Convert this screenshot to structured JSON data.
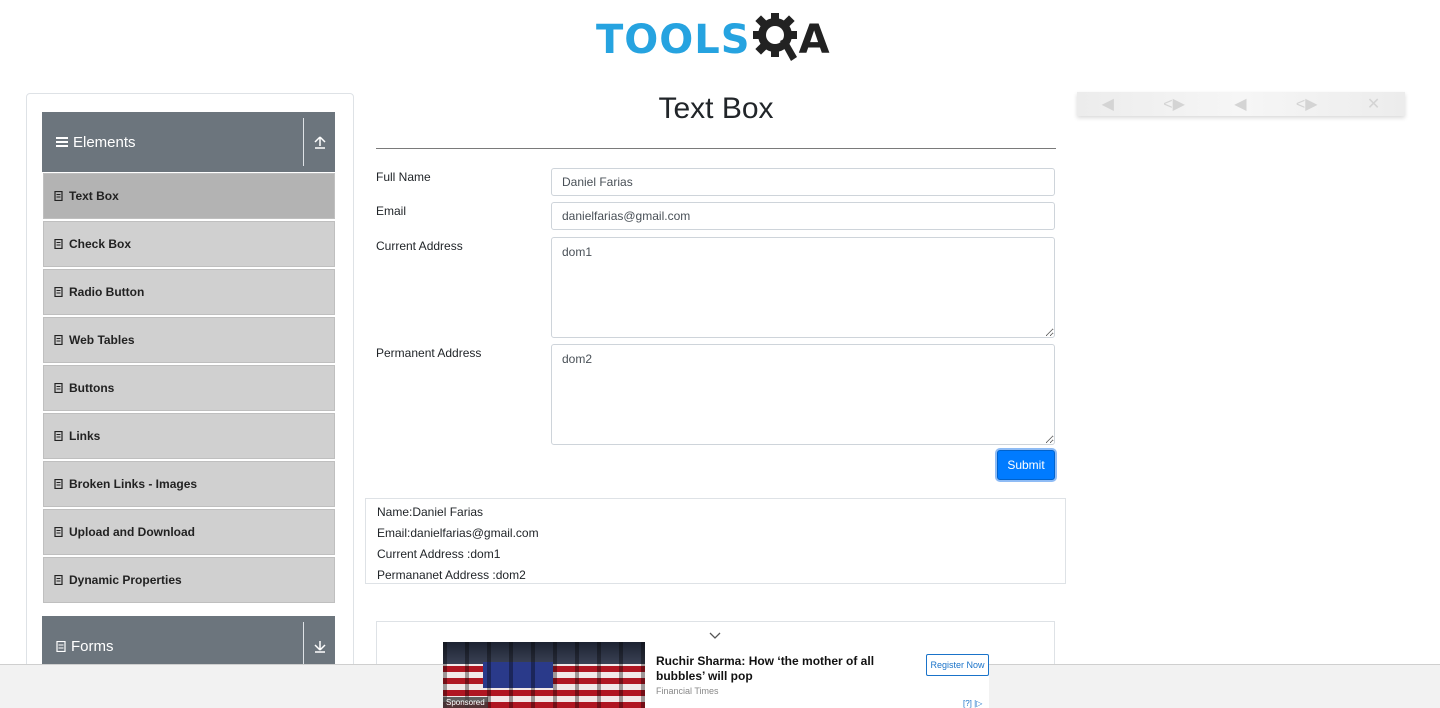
{
  "header": {
    "logo_text": "TOOLS",
    "logo_tail": "A"
  },
  "sidebar": {
    "groups": [
      {
        "label": "Elements",
        "icon": "list-icon",
        "toggle_icon": "arrow-up-icon"
      },
      {
        "label": "Forms",
        "icon": "document-icon",
        "toggle_icon": "arrow-down-icon"
      }
    ],
    "items": [
      {
        "label": "Text Box",
        "active": true
      },
      {
        "label": "Check Box"
      },
      {
        "label": "Radio Button"
      },
      {
        "label": "Web Tables"
      },
      {
        "label": "Buttons"
      },
      {
        "label": "Links"
      },
      {
        "label": "Broken Links - Images"
      },
      {
        "label": "Upload and Download"
      },
      {
        "label": "Dynamic Properties"
      }
    ]
  },
  "main": {
    "title": "Text Box",
    "form": {
      "full_name_label": "Full Name",
      "full_name_value": "Daniel Farias",
      "email_label": "Email",
      "email_value": "danielfarias@gmail.com",
      "current_address_label": "Current Address",
      "current_address_value": "dom1",
      "permanent_address_label": "Permanent Address",
      "permanent_address_value": "dom2",
      "submit_label": "Submit"
    },
    "output": {
      "name": "Name:Daniel Farias",
      "email": "Email:danielfarias@gmail.com",
      "current_address": "Current Address :dom1",
      "permanent_address": "Permananet Address :dom2"
    }
  },
  "ad": {
    "sponsored": "Sponsored",
    "headline": "Ruchir Sharma: How ‘the mother of all bubbles’ will pop",
    "source": "Financial Times",
    "cta": "Register Now",
    "choices": "[?] |▷"
  },
  "colors": {
    "brand_blue": "#26a3e0",
    "sidebar_header": "#6c757d",
    "menu_item_bg": "#d0d0d0",
    "primary_button": "#007bff"
  }
}
